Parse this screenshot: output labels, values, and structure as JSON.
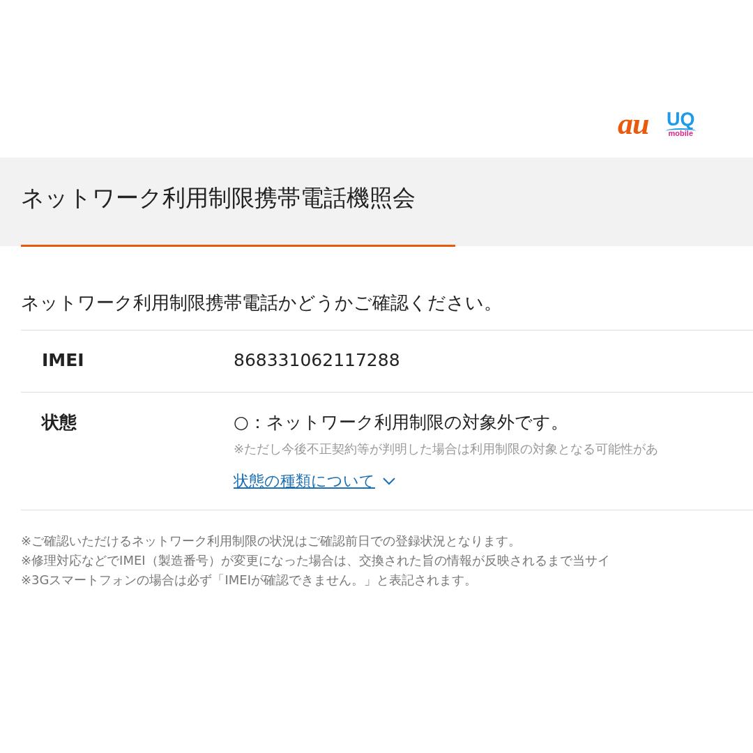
{
  "logos": [
    {
      "kind": "au",
      "text": "au"
    },
    {
      "kind": "uq",
      "text": "UQ",
      "sub": "mobile"
    }
  ],
  "page_title": "ネットワーク利用制限携帯電話機照会",
  "intro": "ネットワーク利用制限携帯電話かどうかご確認ください。",
  "rows": [
    {
      "label": "IMEI",
      "value": "868331062117288"
    },
    {
      "label": "状態",
      "value": "○：ネットワーク利用制限の対象外です。",
      "note": "※ただし今後不正契約等が判明した場合は利用制限の対象となる可能性があ",
      "link": "状態の種類について",
      "expanded": false
    }
  ],
  "notes": [
    "※ご確認いただけるネットワーク利用制限の状況はご確認前日での登録状況となります。",
    "※修理対応などでIMEI（製造番号）が変更になった場合は、交換された旨の情報が反映されるまで当サイ",
    "※3Gスマートフォンの場合は必ず「IMEIが確認できません。」と表記されます。"
  ]
}
